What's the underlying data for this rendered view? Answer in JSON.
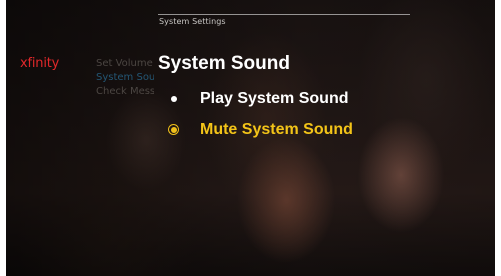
{
  "header": {
    "breadcrumb": "System Settings"
  },
  "brand": {
    "logo_text": "xfinity",
    "logo_color": "#e0282a"
  },
  "side_menu": {
    "items": [
      {
        "label": "Set Volume",
        "state": "normal"
      },
      {
        "label": "System Sound",
        "state": "active"
      },
      {
        "label": "Check Messages",
        "state": "normal"
      }
    ]
  },
  "panel": {
    "title": "System Sound",
    "options": [
      {
        "label": "Play System Sound",
        "selected": false,
        "icon": "radio-dot-icon"
      },
      {
        "label": "Mute System Sound",
        "selected": true,
        "icon": "radio-selected-icon"
      }
    ]
  },
  "colors": {
    "accent": "#f3c418",
    "text": "#ffffff"
  }
}
